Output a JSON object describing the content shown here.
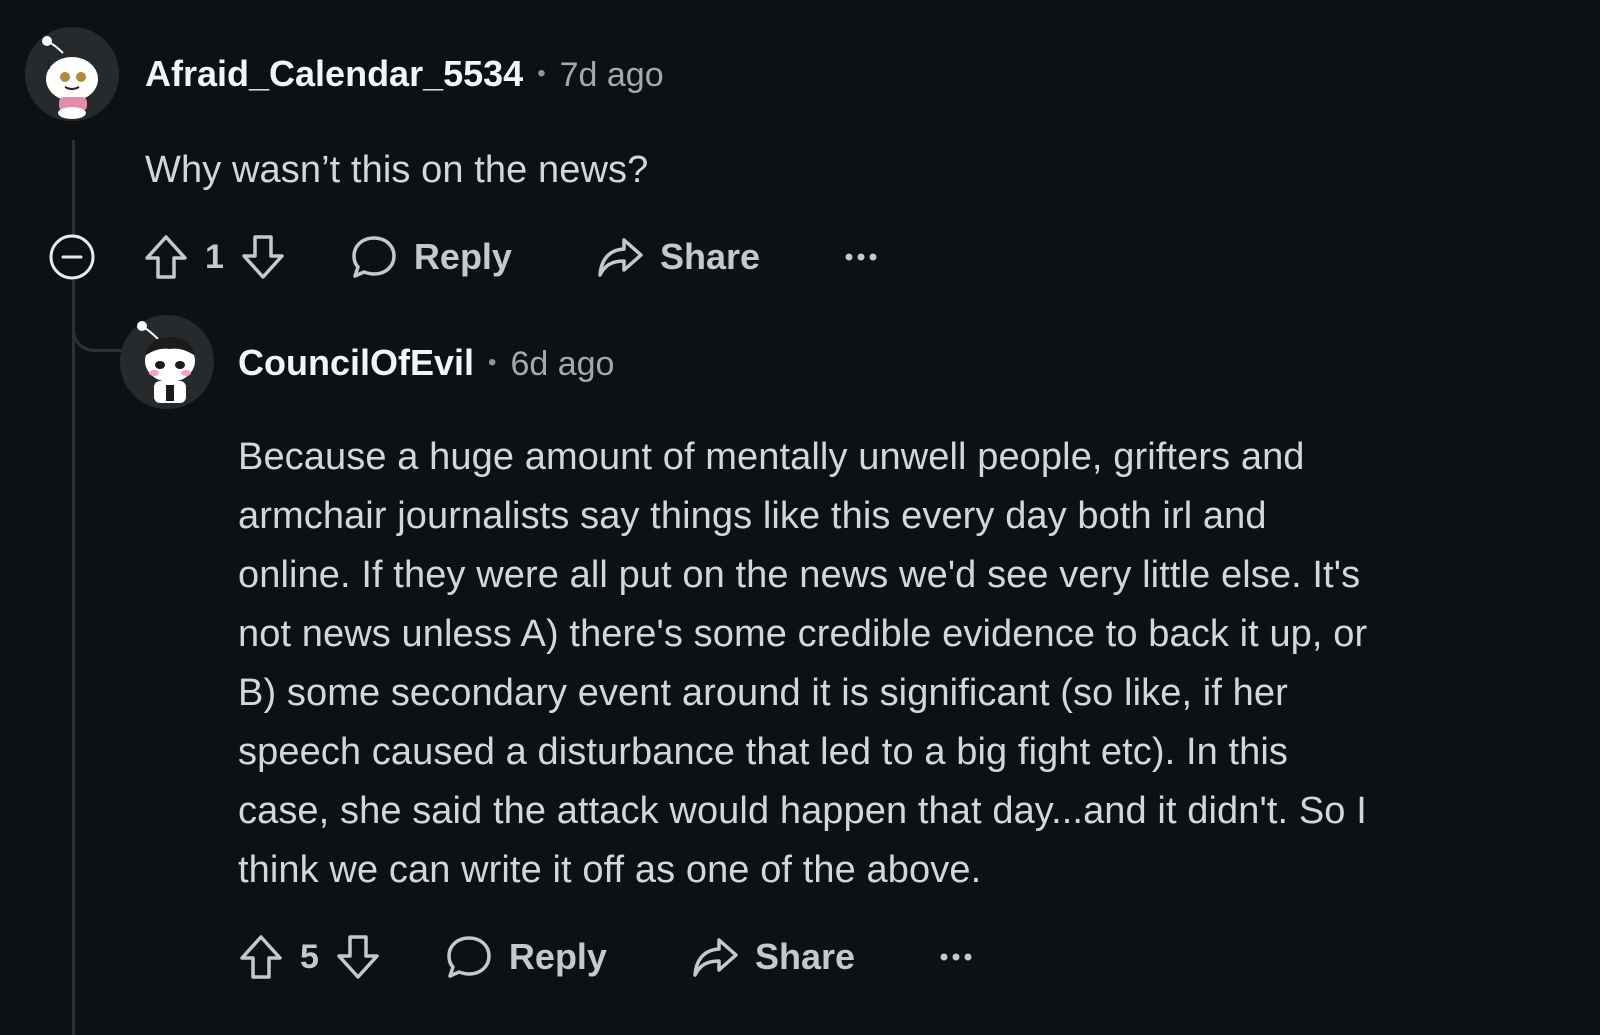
{
  "comments": [
    {
      "username": "Afraid_Calendar_5534",
      "separator": "•",
      "timestamp": "7d ago",
      "body": "Why wasn’t this on the news?",
      "votes": "1",
      "reply_label": "Reply",
      "share_label": "Share"
    },
    {
      "username": "CouncilOfEvil",
      "separator": "•",
      "timestamp": "6d ago",
      "body_lines": [
        "Because a huge amount of mentally unwell people, grifters and",
        "armchair journalists say things like this every day both irl and",
        "online. If they were all put on the news we'd see very little else. It's",
        "not news unless A) there's some credible evidence to back it up, or",
        "B) some secondary event around it is significant (so like, if her",
        "speech caused a disturbance that led to a big fight etc). In this",
        "case, she said the attack would happen that day...and it didn't. So I",
        "think we can write it off as one of the above."
      ],
      "votes": "5",
      "reply_label": "Reply",
      "share_label": "Share"
    }
  ],
  "icons": {
    "collapse": "minus-circle-icon",
    "upvote": "arrow-up-icon",
    "downvote": "arrow-down-icon",
    "reply": "speech-bubble-icon",
    "share": "share-arrow-icon",
    "more": "ellipsis-icon"
  },
  "colors": {
    "background": "#0e1113",
    "text": "#d7dadc",
    "muted": "#a3aaad",
    "thread_line": "#2c3134"
  }
}
